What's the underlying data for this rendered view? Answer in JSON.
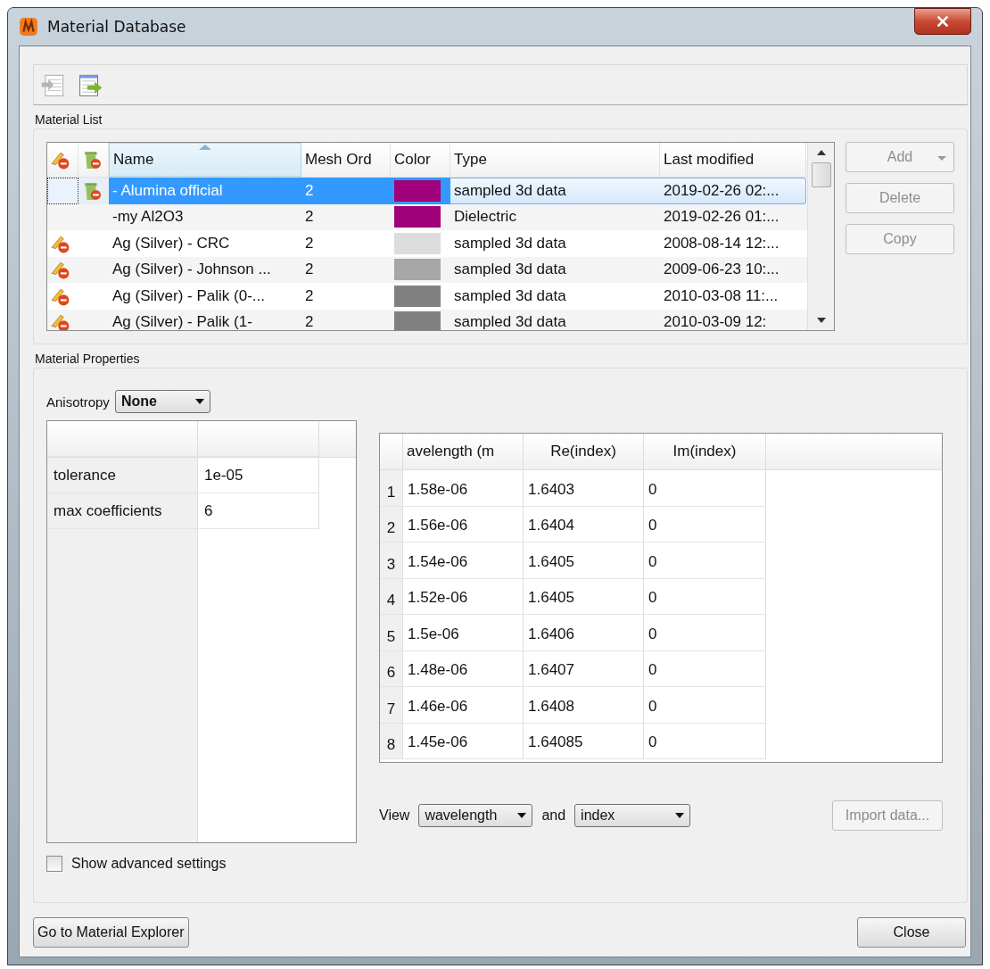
{
  "window": {
    "title": "Material Database"
  },
  "material_list": {
    "label": "Material List",
    "columns": [
      {
        "label": "Name",
        "sorted": true
      },
      {
        "label": "Mesh Ord",
        "sorted": false
      },
      {
        "label": "Color",
        "sorted": false
      },
      {
        "label": "Type",
        "sorted": false
      },
      {
        "label": "Last modified",
        "sorted": false
      }
    ],
    "rows": [
      {
        "name": "- Alumina official",
        "mesh_order": "2",
        "color": "#a0007a",
        "type": "sampled 3d data",
        "modified": "2019-02-26 02:...",
        "selected": true,
        "no_edit": false,
        "no_delete": true
      },
      {
        "name": "-my Al2O3",
        "mesh_order": "2",
        "color": "#a0007a",
        "type": "Dielectric",
        "modified": "2019-02-26 01:...",
        "selected": false,
        "no_edit": false,
        "no_delete": false
      },
      {
        "name": "Ag (Silver) - CRC",
        "mesh_order": "2",
        "color": "#dcdcdc",
        "type": "sampled 3d data",
        "modified": "2008-08-14 12:...",
        "selected": false,
        "no_edit": true,
        "no_delete": false
      },
      {
        "name": "Ag (Silver) - Johnson ...",
        "mesh_order": "2",
        "color": "#a5a8a6",
        "type": "sampled 3d data",
        "modified": "2009-06-23 10:...",
        "selected": false,
        "no_edit": true,
        "no_delete": false
      },
      {
        "name": "Ag (Silver) - Palik (0-...",
        "mesh_order": "2",
        "color": "#808080",
        "type": "sampled 3d data",
        "modified": "2010-03-08 11:...",
        "selected": false,
        "no_edit": true,
        "no_delete": false
      },
      {
        "name": "Ag (Silver) - Palik (1-",
        "mesh_order": "2",
        "color": "#808080",
        "type": "sampled 3d data",
        "modified": "2010-03-09 12:",
        "selected": false,
        "no_edit": true,
        "no_delete": false
      }
    ],
    "buttons": [
      {
        "label": "Add",
        "kind": "dropdown",
        "disabled": true
      },
      {
        "label": "Delete",
        "kind": "plain",
        "disabled": true
      },
      {
        "label": "Copy",
        "kind": "plain",
        "disabled": true
      }
    ]
  },
  "properties": {
    "label": "Material Properties",
    "anisotropy": {
      "label": "Anisotropy",
      "value": "None"
    },
    "parameters": [
      {
        "name": "tolerance",
        "value": "1e-05"
      },
      {
        "name": "max coefficients",
        "value": "6"
      }
    ],
    "data_table": {
      "columns": [
        "avelength (m",
        "Re(index)",
        "Im(index)"
      ],
      "rows": [
        {
          "index": "1",
          "wavelength": "1.58e-06",
          "re": "1.6403",
          "im": "0"
        },
        {
          "index": "2",
          "wavelength": "1.56e-06",
          "re": "1.6404",
          "im": "0"
        },
        {
          "index": "3",
          "wavelength": "1.54e-06",
          "re": "1.6405",
          "im": "0"
        },
        {
          "index": "4",
          "wavelength": "1.52e-06",
          "re": "1.6405",
          "im": "0"
        },
        {
          "index": "5",
          "wavelength": "1.5e-06",
          "re": "1.6406",
          "im": "0"
        },
        {
          "index": "6",
          "wavelength": "1.48e-06",
          "re": "1.6407",
          "im": "0"
        },
        {
          "index": "7",
          "wavelength": "1.46e-06",
          "re": "1.6408",
          "im": "0"
        },
        {
          "index": "8",
          "wavelength": "1.45e-06",
          "re": "1.64085",
          "im": "0"
        }
      ]
    },
    "view": {
      "label": "View",
      "x_axis": "wavelength",
      "joiner": "and",
      "y_axis": "index"
    },
    "import_button": {
      "label": "Import data...",
      "disabled": true
    },
    "advanced": {
      "label": "Show advanced settings",
      "checked": false
    }
  },
  "footer": {
    "explorer_button": "Go to Material Explorer",
    "close_button": "Close"
  }
}
